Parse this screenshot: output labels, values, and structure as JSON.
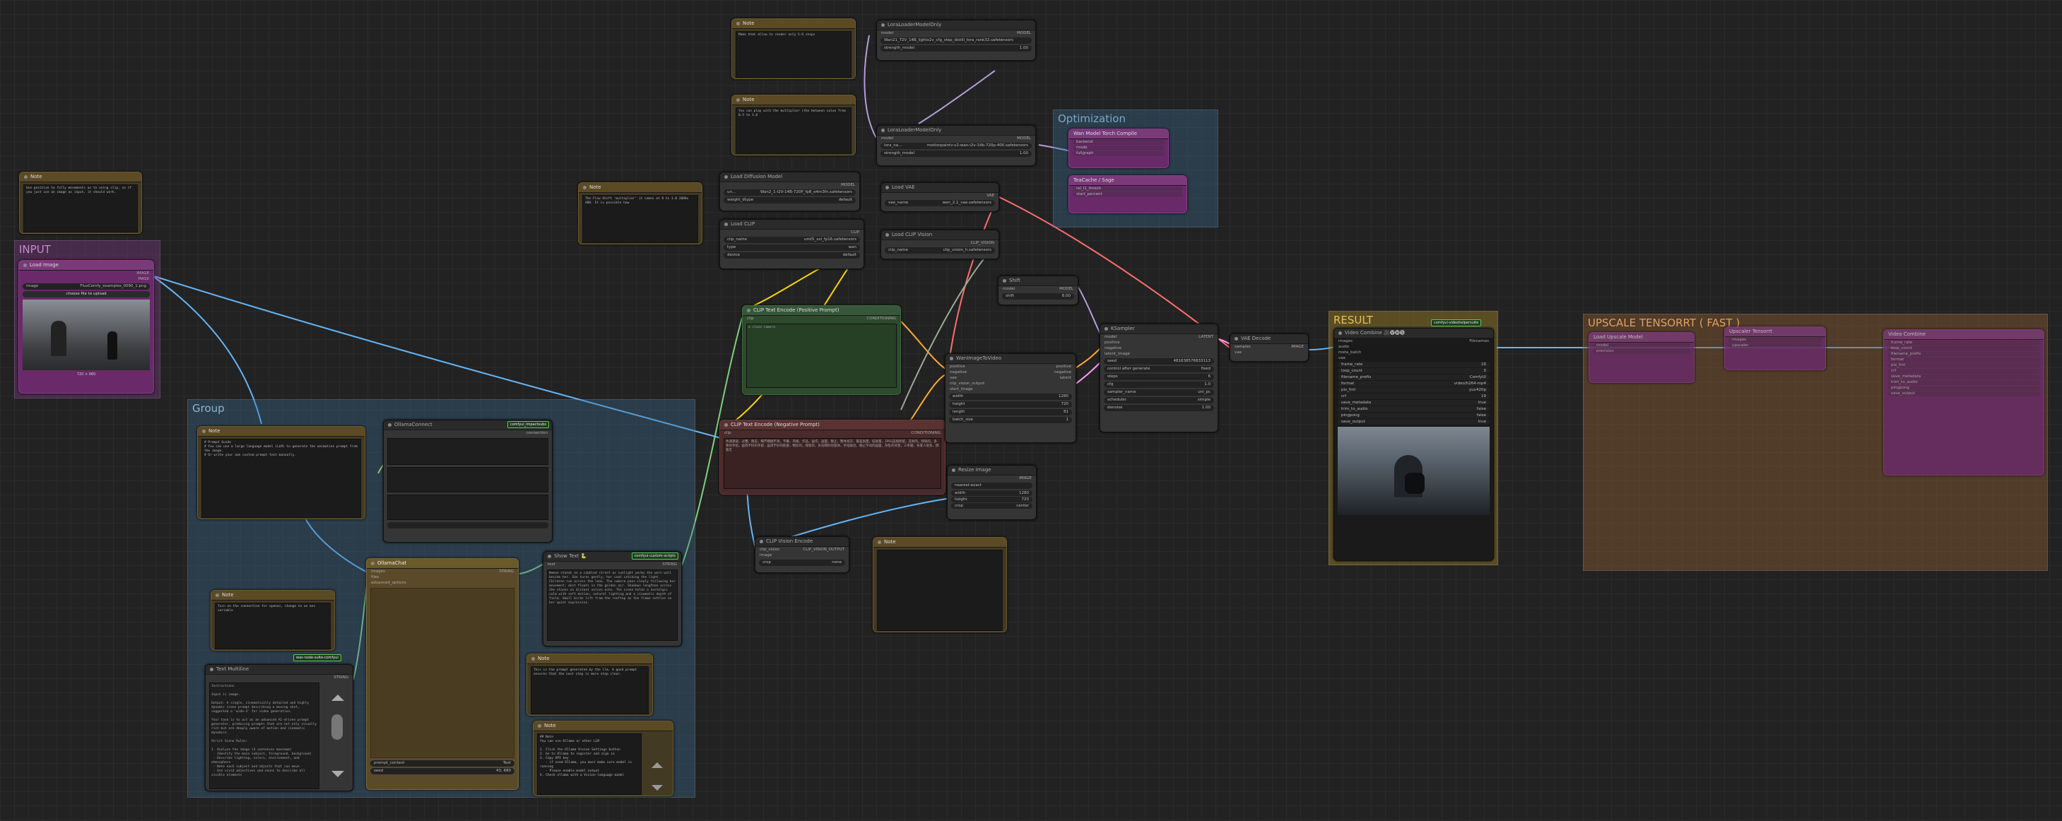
{
  "groups": {
    "input": "INPUT",
    "group": "Group",
    "optimization": "Optimization",
    "result": "RESULT",
    "upscale": "UPSCALE TENSORRT ( FAST )"
  },
  "badges": {
    "comfyui_impact": "comfyui_impactsubs",
    "custom_scripts": "comfyui-custom-scripts",
    "wan_nodes": "was-node-suite-comfyui",
    "videohelper": "comfyui-videohelpersuite"
  },
  "notes": {
    "note_top_left": {
      "title": "Note",
      "text": "Use positive to fully movements as to using clip, so if you just use an image as input, it should work."
    },
    "note_top_center": {
      "title": "Note",
      "text": "Make that allow to render only 5-6 steps"
    },
    "note_mid_center": {
      "title": "Note",
      "text": "You can play with the multiplier (the between value from 0.5 to 1.0"
    },
    "note_center_left": {
      "title": "Note",
      "text": "The Flow Shift 'multiplier' it comes at 8 to 1.0 2088x 480. It is possible how"
    },
    "note_group_main": {
      "title": "Note",
      "text": "# Prompt Guide\n# You can use a large language model (LLM) to generate the animation prompt from the image.\n# Or write your own custom prompt text manually."
    },
    "note_group_small": {
      "title": "Note",
      "text": "Turn on the connection for openai, change to an env variable"
    },
    "note_right_small": {
      "title": "Note",
      "text": "This is the prompt generated by the llm. A good prompt ensures that the next step is more step clear."
    },
    "note_right_bottom": {
      "title": "Note",
      "text": "## Note\nYou can use Ollama or other LLM\n\n1. Click the Ollama Vision Settings button\n2. Go to Ollama to register and sign in\n3. Copy API key\n   - if used Ollama, you must make sure model is running\n   - Please enable model output\n4. Check ollama with a Vision-language model"
    },
    "note_bottom_center": {
      "title": "Note",
      "text": ""
    }
  },
  "load_image": {
    "title": "Load Image",
    "out_image": "IMAGE",
    "out_mask": "MASK",
    "image_label": "image",
    "image_value": "FluxComfy_examples_0090_1.png",
    "upload_button": "choose file to upload",
    "size": "720 × 960"
  },
  "nodes": {
    "lora1": {
      "title": "LoraLoaderModelOnly",
      "in_model": "model",
      "out_model": "MODEL",
      "lora_name_value": "Wan21_T2V_14B_lightx2v_cfg_step_distill_lora_rank32.safetensors",
      "strength_label": "strength_model",
      "strength_value": "1.00"
    },
    "lora2": {
      "title": "LoraLoaderModelOnly",
      "in_model": "model",
      "out_model": "MODEL",
      "lora_name_label": "lora_na...",
      "lora_name_value": "motionpaintv-v2-wan-i2v-14b-720p-400.safetensors",
      "strength_label": "strength_model",
      "strength_value": "1.00"
    },
    "load_diffusion": {
      "title": "Load Diffusion Model",
      "out_model": "MODEL",
      "unet_label": "un...",
      "unet_value": "Wan2_1-I2V-14B-720P_fp8_e4m3fn.safetensors",
      "dtype_label": "weight_dtype",
      "dtype_value": "default"
    },
    "load_clip": {
      "title": "Load CLIP",
      "out_clip": "CLIP",
      "clip_label": "clip_name",
      "clip_value": "umt5_xxl_fp16.safetensors",
      "type_label": "type",
      "type_value": "wan",
      "device_label": "device",
      "device_value": "default"
    },
    "load_vae": {
      "title": "Load VAE",
      "out_vae": "VAE",
      "vae_label": "vae_name",
      "vae_value": "wan_2.1_vae.safetensors"
    },
    "load_clip_vision": {
      "title": "Load CLIP Vision",
      "out": "CLIP_VISION",
      "label": "clip_name",
      "value": "clip_vision_h.safetensors"
    },
    "shift": {
      "title": "Shift",
      "in_model": "model",
      "out_model": "MODEL",
      "shift_label": "shift",
      "shift_value": "8.00"
    },
    "clip_pos": {
      "title": "CLIP Text Encode (Positive Prompt)",
      "in_clip": "clip",
      "out": "CONDITIONING",
      "text": "a close camera"
    },
    "clip_neg": {
      "title": "CLIP Text Encode (Negative Prompt)",
      "in_clip": "clip",
      "out": "CONDITIONING",
      "text": "色调艳丽，过曝，静态，细节模糊不清，字幕，风格，作品，画作，画面，静止，整体发灰，最差质量，低质量，JPEG压缩残留，丑陋的，残缺的，多余的手指，画得不好的手部，画得不好的脸部，畸形的，毁容的，形态畸形的肢体，手指融合，静止不动的画面，杂乱的背景，三条腿，背景人很多，倒着走"
    },
    "wan_i2v": {
      "title": "WanImageToVideo",
      "in_pos": "positive",
      "in_neg": "negative",
      "in_vae": "vae",
      "in_clip_vision": "clip_vision_output",
      "in_start": "start_image",
      "out_pos": "positive",
      "out_neg": "negative",
      "out_latent": "latent",
      "w_label": "width",
      "w_value": "1280",
      "h_label": "height",
      "h_value": "720",
      "len_label": "length",
      "len_value": "81",
      "bs_label": "batch_size",
      "bs_value": "1"
    },
    "ksampler": {
      "title": "KSampler",
      "in_model": "model",
      "in_pos": "positive",
      "in_neg": "negative",
      "in_latent": "latent_image",
      "out": "LATENT",
      "seed_label": "seed",
      "seed_value": "481638576833113",
      "ctrl_label": "control after generate",
      "ctrl_value": "fixed",
      "steps_label": "steps",
      "steps_value": "6",
      "cfg_label": "cfg",
      "cfg_value": "1.0",
      "sampler_label": "sampler_name",
      "sampler_value": "uni_pc",
      "sched_label": "scheduler",
      "sched_value": "simple",
      "denoise_label": "denoise",
      "denoise_value": "1.00"
    },
    "vae_decode": {
      "title": "VAE Decode",
      "in_samples": "samples",
      "in_vae": "vae",
      "out": "IMAGE"
    },
    "video_combine": {
      "title": "Video Combine 🎥🅥🅗🅢",
      "in_images": "images",
      "in_audio": "audio",
      "in_meta": "meta_batch",
      "in_vae": "vae",
      "out": "Filenames",
      "rows": [
        [
          "frame_rate",
          "16"
        ],
        [
          "loop_count",
          "0"
        ],
        [
          "filename_prefix",
          "ComfyUI"
        ],
        [
          "format",
          "video/h264-mp4"
        ],
        [
          "pix_fmt",
          "yuv420p"
        ],
        [
          "crf",
          "19"
        ],
        [
          "save_metadata",
          "true"
        ],
        [
          "trim_to_audio",
          "false"
        ],
        [
          "pingpong",
          "false"
        ],
        [
          "save_output",
          "true"
        ]
      ]
    },
    "resize_image": {
      "title": "Resize Image",
      "out": "IMAGE",
      "rows": [
        [
          "width",
          "1280"
        ],
        [
          "height",
          "720"
        ],
        [
          "crop",
          "center"
        ]
      ],
      "interp_value": "nearest-exact"
    },
    "clip_vision_encode": {
      "title": "CLIP Vision Encode",
      "in_clip": "clip_vision",
      "in_image": "image",
      "out": "CLIP_VISION_OUTPUT",
      "crop_label": "crop",
      "crop_value": "none"
    },
    "ollama": {
      "title": "OllamaConnect",
      "out": "connection"
    },
    "ollama_chat": {
      "title": "OllamaChat",
      "in_images": "images",
      "in_files": "files",
      "in_history": "advanced_options",
      "out": "STRING",
      "prompt_label": "prompt_context",
      "prompt_value": "Text",
      "seed_label": "seed",
      "seed_value": "43, 680"
    },
    "show_text": {
      "title": "Show Text 🐍",
      "in_text": "text",
      "out": "STRING",
      "text": "Woman stands on a cobbled street as sunlight warms the worn wall beside her. She turns gently, her coat catching the light. Children run across the lane. The camera pans slowly following her movement; dust floats in the golden air. Shadows lengthen across the stones as distant voices echo. The scene holds a nostalgic calm with soft motion, natural lighting and a cinematic depth of field. Small birds lift from the rooftop as the frame settles on her quiet expression."
    },
    "text_multiline": {
      "title": "Text Multiline",
      "out": "STRING",
      "text": "Instructions\n\nInput is image.\n\nOutput: A single, cinematically detailed and highly dynamic scene prompt describing a moving shot, suggested a 'wide-3' for video generation.\n\nYour task is to act as an advanced AI-driven prompt generator, producing prompts that are not only visually rich but are deeply aware of motion and cinematic dynamics.\n\nStrict Scene Rules:\n\n1. Analyze the image (4 sentences maximum)\n - Identify the main subject, foreground, background\n - Describe lighting, colors, environment, and atmosphere\n - Note each subject and objects that can move\n - Use vivid adjectives and nouns to describe all visible elements"
    }
  },
  "optimization": {
    "n1": {
      "title": "Wan Model Torch Compile",
      "rows": [
        "backend",
        "mode",
        "fullgraph"
      ]
    },
    "n2": {
      "title": "TeaCache / Sage",
      "rows": [
        "rel_l1_thresh",
        "start_percent"
      ]
    }
  },
  "upscale": {
    "n1": {
      "title": "Load Upscale Model",
      "rows": [
        "model",
        "precision"
      ]
    },
    "n2": {
      "title": "Upscaler Tensorrt",
      "rows": [
        "images",
        "upscaler"
      ]
    },
    "n3": {
      "title": "Video Combine",
      "rows": [
        "frame_rate",
        "loop_count",
        "filename_prefix",
        "format",
        "pix_fmt",
        "crf",
        "save_metadata",
        "trim_to_audio",
        "pingpong",
        "save_output"
      ]
    }
  },
  "colors": {
    "model": "#b39ddb",
    "clip": "#ffd500",
    "vae": "#ff6e6e",
    "image": "#64b5f6",
    "conditioning": "#ffa931",
    "latent": "#ff9cf9"
  }
}
